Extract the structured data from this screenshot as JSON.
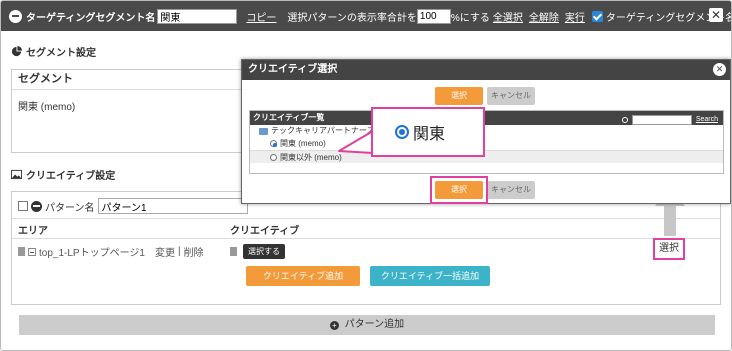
{
  "topbar": {
    "title": "ターゲティングセグメント名",
    "segment_name": "関東",
    "copy_link": "コピー",
    "rate_label": "選択パターンの表示率合計を",
    "rate_value": "100",
    "rate_suffix": "%にする",
    "select_all": "全選択",
    "deselect_all": "全解除",
    "execute": "実行",
    "auto_input_label": "ターゲティングセグメント名自動入力",
    "close": "✕"
  },
  "segment_section": {
    "heading": "セグメント設定",
    "column_header": "セグメント",
    "value": "関東 (memo)"
  },
  "creative_section": {
    "heading": "クリエイティブ設定",
    "pattern_label": "パターン名",
    "pattern_value": "パターン1",
    "col_area": "エリア",
    "col_creative": "クリエイティブ",
    "area_item": "top_1-LPトップページ1",
    "change": "変更",
    "separator": "|",
    "delete": "削除",
    "select_button": "選択する",
    "add_creative": "クリエイティブ追加",
    "bulk_add_creative": "クリエイティブ一括追加",
    "right_select": "選択",
    "add_pattern": "パターン追加"
  },
  "modal": {
    "title": "クリエイティブ選択",
    "close": "✕",
    "select": "選択",
    "cancel": "キャンセル",
    "list_title": "クリエイティブ一覧",
    "search_link": "Search",
    "folder": "テックキャリアパートナーズ",
    "items": [
      "関東 (memo)",
      "関東以外 (memo)"
    ]
  },
  "callout": {
    "label": "関東"
  },
  "colors": {
    "topbar": "#4a4a4a",
    "accent_orange": "#f39a3a",
    "accent_teal": "#3cb3c8",
    "highlight": "#e040a0",
    "radio_blue": "#1e73d8"
  }
}
